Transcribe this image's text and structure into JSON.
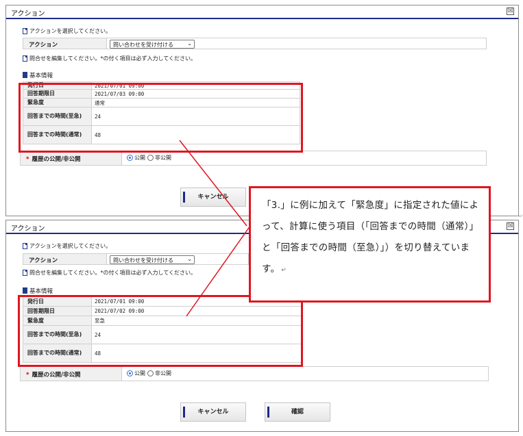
{
  "top_window": {
    "title": "アクション",
    "close_glyph": "☒",
    "select_action_hint": "アクションを選択してください。",
    "action_label": "アクション",
    "action_select_value": "問い合わせを受け付ける",
    "edit_hint": "問合せを編集してください。*の付く項目は必ず入力してください。",
    "section_title": "基本情報",
    "rows": [
      {
        "label": "発行日",
        "value": "2021/07/01 09:00"
      },
      {
        "label": "回答期限日",
        "value": "2021/07/03 09:00"
      },
      {
        "label": "緊急度",
        "value": "通常"
      },
      {
        "label": "回答までの時間(至急)",
        "value": "24"
      },
      {
        "label": "回答までの時間(通常)",
        "value": "48"
      }
    ],
    "history_required_mark": "*",
    "history_label": "履歴の公開/非公開",
    "radio_public": "公開",
    "radio_private": "非公開",
    "cancel_label": "キャンセル"
  },
  "bottom_window": {
    "title": "アクション",
    "close_glyph": "☒",
    "select_action_hint": "アクションを選択してください。",
    "action_label": "アクション",
    "action_select_value": "問い合わせを受け付ける",
    "edit_hint": "問合せを編集してください。*の付く項目は必ず入力してください。",
    "section_title": "基本情報",
    "rows": [
      {
        "label": "発行日",
        "value": "2021/07/01 09:00"
      },
      {
        "label": "回答期限日",
        "value": "2021/07/02 09:00"
      },
      {
        "label": "緊急度",
        "value": "至急"
      },
      {
        "label": "回答までの時間(至急)",
        "value": "24"
      },
      {
        "label": "回答までの時間(通常)",
        "value": "48"
      }
    ],
    "history_required_mark": "*",
    "history_label": "履歴の公開/非公開",
    "radio_public": "公開",
    "radio_private": "非公開",
    "cancel_label": "キャンセル",
    "confirm_label": "確認"
  },
  "callout": {
    "text": "「3.」に例に加えて「緊急度」に指定された値によって、計算に使う項目（「回答までの時間（通常）」と「回答までの時間（至急）」）を切り替えています。",
    "return_mark": "↵"
  },
  "colors": {
    "highlight": "#e0141e",
    "title_rule": "#1c2a8a",
    "radio_on": "#2a6fd6"
  }
}
